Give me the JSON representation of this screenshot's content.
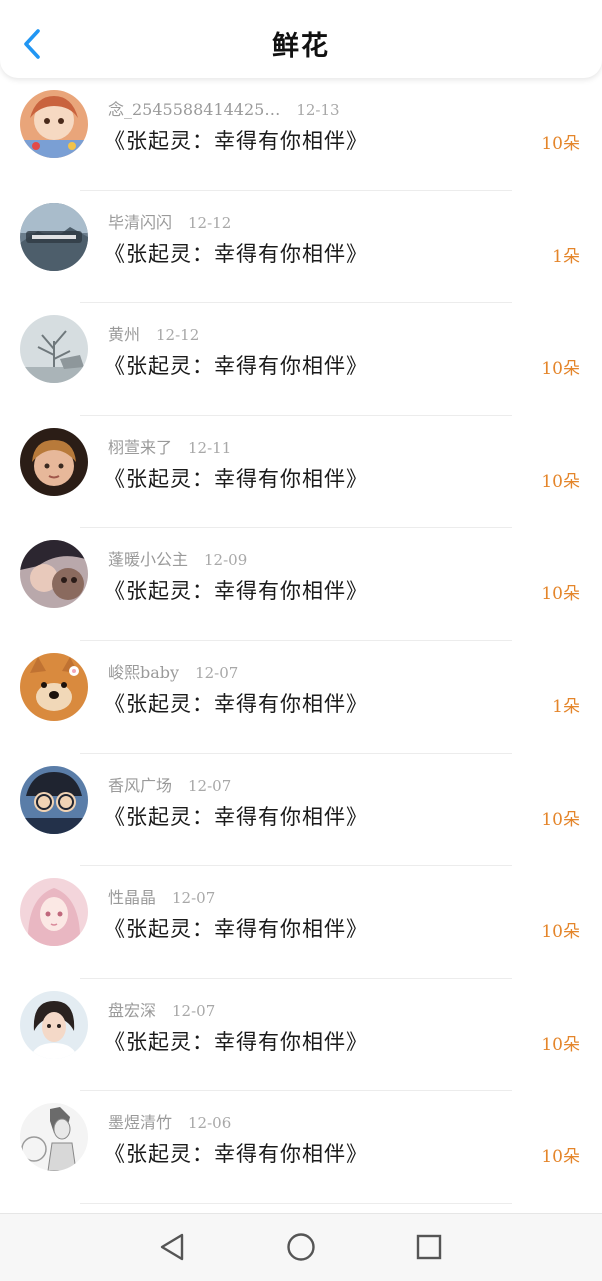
{
  "header": {
    "title": "鲜花",
    "back_icon": "chevron-left-icon",
    "accent_color": "#2196f3"
  },
  "gifts": [
    {
      "user": "念_2545588414425…",
      "date": "12-13",
      "book": "《张起灵：幸得有你相伴》",
      "count": "10朵",
      "avatar": "anime-girl-red-hair"
    },
    {
      "user": "毕清闪闪",
      "date": "12-12",
      "book": "《张起灵：幸得有你相伴》",
      "count": "1朵",
      "avatar": "landscape-badge"
    },
    {
      "user": "黄州",
      "date": "12-12",
      "book": "《张起灵：幸得有你相伴》",
      "count": "10朵",
      "avatar": "winter-tree"
    },
    {
      "user": "栩萱来了",
      "date": "12-11",
      "book": "《张起灵：幸得有你相伴》",
      "count": "10朵",
      "avatar": "child-portrait"
    },
    {
      "user": "蓬暖小公主",
      "date": "12-09",
      "book": "《张起灵：幸得有你相伴》",
      "count": "10朵",
      "avatar": "girl-with-dog"
    },
    {
      "user": "峻熙baby",
      "date": "12-07",
      "book": "《张起灵：幸得有你相伴》",
      "count": "1朵",
      "avatar": "shiba-dog"
    },
    {
      "user": "香风广场",
      "date": "12-07",
      "book": "《张起灵：幸得有你相伴》",
      "count": "10朵",
      "avatar": "cartoon-detective"
    },
    {
      "user": "性晶晶",
      "date": "12-07",
      "book": "《张起灵：幸得有你相伴》",
      "count": "10朵",
      "avatar": "anime-girl-pink"
    },
    {
      "user": "盘宏深",
      "date": "12-07",
      "book": "《张起灵：幸得有你相伴》",
      "count": "10朵",
      "avatar": "girl-photo"
    },
    {
      "user": "墨煜清竹",
      "date": "12-06",
      "book": "《张起灵：幸得有你相伴》",
      "count": "10朵",
      "avatar": "anime-boy-sketch"
    }
  ],
  "nav": {
    "back": "nav-back-icon",
    "home": "nav-home-icon",
    "recents": "nav-recents-icon"
  }
}
